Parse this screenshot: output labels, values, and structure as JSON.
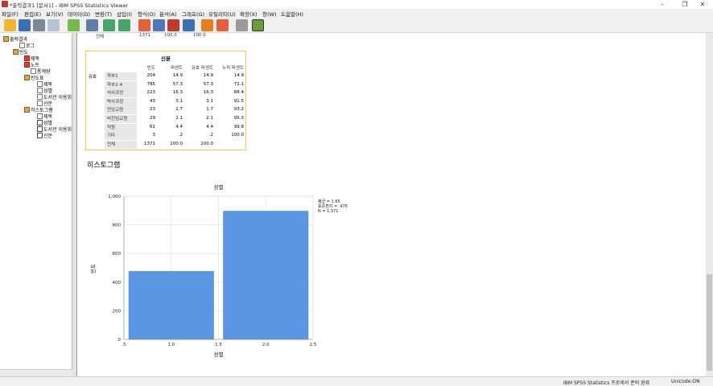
{
  "window": {
    "title": "*출력결과1 [문서1] - IBM SPSS Statistics Viewer"
  },
  "menu": [
    "파일(F)",
    "편집(E)",
    "보기(V)",
    "데이터(D)",
    "변환(T)",
    "삽입(I)",
    "형식(O)",
    "분석(A)",
    "그래프(G)",
    "유틸리티(U)",
    "확장(X)",
    "창(W)",
    "도움말(H)"
  ],
  "window_controls": {
    "minimize": "–",
    "restore": "❐",
    "close": "✕"
  },
  "tree": {
    "root": "출력결과",
    "log": "로그",
    "freq": "빈도",
    "freq_title": "제목",
    "notes": "노트",
    "stats": "통계량",
    "freq_table": "빈도표",
    "ft_title": "제목",
    "ft_gender": "성별",
    "ft_lib": "도서관 이용회",
    "ft_status": "신분",
    "hist": "히스토그램",
    "h_title": "제목",
    "h_gender": "성별",
    "h_lib": "도서관 이용회",
    "h_status": "신분"
  },
  "prev_table_total": {
    "label": "전체",
    "count": "1371",
    "pct": "100.0",
    "valid": "100.0"
  },
  "freq_table": {
    "title": "신분",
    "headers": [
      "빈도",
      "퍼센트",
      "유효 퍼센트",
      "누적 퍼센트"
    ],
    "group_label": "유효",
    "rows": [
      {
        "label": "학부1",
        "freq": "204",
        "pct": "14.9",
        "valid": "14.9",
        "cum": "14.9"
      },
      {
        "label": "학부2-4",
        "freq": "785",
        "pct": "57.3",
        "valid": "57.3",
        "cum": "72.1"
      },
      {
        "label": "석사과정",
        "freq": "223",
        "pct": "16.3",
        "valid": "16.3",
        "cum": "88.4"
      },
      {
        "label": "박사과정",
        "freq": "43",
        "pct": "3.1",
        "valid": "3.1",
        "cum": "91.5"
      },
      {
        "label": "전임교원",
        "freq": "23",
        "pct": "1.7",
        "valid": "1.7",
        "cum": "93.2"
      },
      {
        "label": "비전임교원",
        "freq": "29",
        "pct": "2.1",
        "valid": "2.1",
        "cum": "95.3"
      },
      {
        "label": "직원",
        "freq": "61",
        "pct": "4.4",
        "valid": "4.4",
        "cum": "99.8"
      },
      {
        "label": "기타",
        "freq": "3",
        "pct": ".2",
        "valid": ".2",
        "cum": "100.0"
      },
      {
        "label": "전체",
        "freq": "1371",
        "pct": "100.0",
        "valid": "100.0",
        "cum": ""
      }
    ]
  },
  "section_title": "히스토그램",
  "chart_data": {
    "type": "bar",
    "title": "성별",
    "xlabel": "성별",
    "ylabel": "빈도",
    "bins": [
      {
        "from": 0.5,
        "to": 1.5,
        "count": 475
      },
      {
        "from": 1.5,
        "to": 2.5,
        "count": 896
      }
    ],
    "xticks": [
      ".5",
      "1.0",
      "1.5",
      "2.0",
      "2.5"
    ],
    "yticks": [
      "0",
      "200",
      "400",
      "600",
      "800",
      "1,000"
    ],
    "xlim": [
      0.5,
      2.5
    ],
    "ylim": [
      0,
      1000
    ],
    "stats": [
      "평균 = 1.65",
      "표준편차 = .476",
      "N = 1,371"
    ],
    "grid": true,
    "bar_color": "#5b96e2"
  },
  "status": {
    "processor": "IBM SPSS Statistics 프로세서 준비 완료",
    "unicode": "Unicode:ON"
  }
}
